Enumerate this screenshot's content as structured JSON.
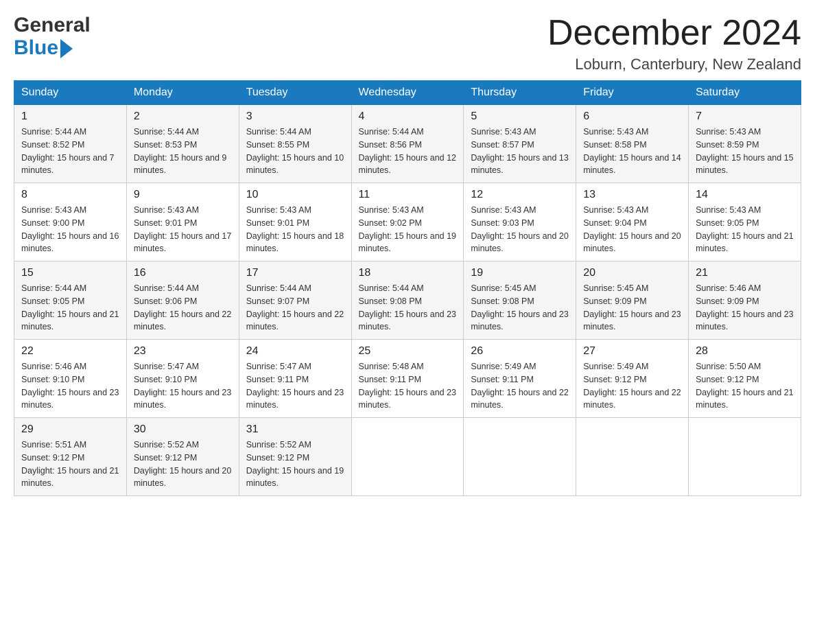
{
  "header": {
    "title": "December 2024",
    "location": "Loburn, Canterbury, New Zealand",
    "logo_general": "General",
    "logo_blue": "Blue"
  },
  "weekdays": [
    "Sunday",
    "Monday",
    "Tuesday",
    "Wednesday",
    "Thursday",
    "Friday",
    "Saturday"
  ],
  "weeks": [
    [
      {
        "day": "1",
        "sunrise": "Sunrise: 5:44 AM",
        "sunset": "Sunset: 8:52 PM",
        "daylight": "Daylight: 15 hours and 7 minutes."
      },
      {
        "day": "2",
        "sunrise": "Sunrise: 5:44 AM",
        "sunset": "Sunset: 8:53 PM",
        "daylight": "Daylight: 15 hours and 9 minutes."
      },
      {
        "day": "3",
        "sunrise": "Sunrise: 5:44 AM",
        "sunset": "Sunset: 8:55 PM",
        "daylight": "Daylight: 15 hours and 10 minutes."
      },
      {
        "day": "4",
        "sunrise": "Sunrise: 5:44 AM",
        "sunset": "Sunset: 8:56 PM",
        "daylight": "Daylight: 15 hours and 12 minutes."
      },
      {
        "day": "5",
        "sunrise": "Sunrise: 5:43 AM",
        "sunset": "Sunset: 8:57 PM",
        "daylight": "Daylight: 15 hours and 13 minutes."
      },
      {
        "day": "6",
        "sunrise": "Sunrise: 5:43 AM",
        "sunset": "Sunset: 8:58 PM",
        "daylight": "Daylight: 15 hours and 14 minutes."
      },
      {
        "day": "7",
        "sunrise": "Sunrise: 5:43 AM",
        "sunset": "Sunset: 8:59 PM",
        "daylight": "Daylight: 15 hours and 15 minutes."
      }
    ],
    [
      {
        "day": "8",
        "sunrise": "Sunrise: 5:43 AM",
        "sunset": "Sunset: 9:00 PM",
        "daylight": "Daylight: 15 hours and 16 minutes."
      },
      {
        "day": "9",
        "sunrise": "Sunrise: 5:43 AM",
        "sunset": "Sunset: 9:01 PM",
        "daylight": "Daylight: 15 hours and 17 minutes."
      },
      {
        "day": "10",
        "sunrise": "Sunrise: 5:43 AM",
        "sunset": "Sunset: 9:01 PM",
        "daylight": "Daylight: 15 hours and 18 minutes."
      },
      {
        "day": "11",
        "sunrise": "Sunrise: 5:43 AM",
        "sunset": "Sunset: 9:02 PM",
        "daylight": "Daylight: 15 hours and 19 minutes."
      },
      {
        "day": "12",
        "sunrise": "Sunrise: 5:43 AM",
        "sunset": "Sunset: 9:03 PM",
        "daylight": "Daylight: 15 hours and 20 minutes."
      },
      {
        "day": "13",
        "sunrise": "Sunrise: 5:43 AM",
        "sunset": "Sunset: 9:04 PM",
        "daylight": "Daylight: 15 hours and 20 minutes."
      },
      {
        "day": "14",
        "sunrise": "Sunrise: 5:43 AM",
        "sunset": "Sunset: 9:05 PM",
        "daylight": "Daylight: 15 hours and 21 minutes."
      }
    ],
    [
      {
        "day": "15",
        "sunrise": "Sunrise: 5:44 AM",
        "sunset": "Sunset: 9:05 PM",
        "daylight": "Daylight: 15 hours and 21 minutes."
      },
      {
        "day": "16",
        "sunrise": "Sunrise: 5:44 AM",
        "sunset": "Sunset: 9:06 PM",
        "daylight": "Daylight: 15 hours and 22 minutes."
      },
      {
        "day": "17",
        "sunrise": "Sunrise: 5:44 AM",
        "sunset": "Sunset: 9:07 PM",
        "daylight": "Daylight: 15 hours and 22 minutes."
      },
      {
        "day": "18",
        "sunrise": "Sunrise: 5:44 AM",
        "sunset": "Sunset: 9:08 PM",
        "daylight": "Daylight: 15 hours and 23 minutes."
      },
      {
        "day": "19",
        "sunrise": "Sunrise: 5:45 AM",
        "sunset": "Sunset: 9:08 PM",
        "daylight": "Daylight: 15 hours and 23 minutes."
      },
      {
        "day": "20",
        "sunrise": "Sunrise: 5:45 AM",
        "sunset": "Sunset: 9:09 PM",
        "daylight": "Daylight: 15 hours and 23 minutes."
      },
      {
        "day": "21",
        "sunrise": "Sunrise: 5:46 AM",
        "sunset": "Sunset: 9:09 PM",
        "daylight": "Daylight: 15 hours and 23 minutes."
      }
    ],
    [
      {
        "day": "22",
        "sunrise": "Sunrise: 5:46 AM",
        "sunset": "Sunset: 9:10 PM",
        "daylight": "Daylight: 15 hours and 23 minutes."
      },
      {
        "day": "23",
        "sunrise": "Sunrise: 5:47 AM",
        "sunset": "Sunset: 9:10 PM",
        "daylight": "Daylight: 15 hours and 23 minutes."
      },
      {
        "day": "24",
        "sunrise": "Sunrise: 5:47 AM",
        "sunset": "Sunset: 9:11 PM",
        "daylight": "Daylight: 15 hours and 23 minutes."
      },
      {
        "day": "25",
        "sunrise": "Sunrise: 5:48 AM",
        "sunset": "Sunset: 9:11 PM",
        "daylight": "Daylight: 15 hours and 23 minutes."
      },
      {
        "day": "26",
        "sunrise": "Sunrise: 5:49 AM",
        "sunset": "Sunset: 9:11 PM",
        "daylight": "Daylight: 15 hours and 22 minutes."
      },
      {
        "day": "27",
        "sunrise": "Sunrise: 5:49 AM",
        "sunset": "Sunset: 9:12 PM",
        "daylight": "Daylight: 15 hours and 22 minutes."
      },
      {
        "day": "28",
        "sunrise": "Sunrise: 5:50 AM",
        "sunset": "Sunset: 9:12 PM",
        "daylight": "Daylight: 15 hours and 21 minutes."
      }
    ],
    [
      {
        "day": "29",
        "sunrise": "Sunrise: 5:51 AM",
        "sunset": "Sunset: 9:12 PM",
        "daylight": "Daylight: 15 hours and 21 minutes."
      },
      {
        "day": "30",
        "sunrise": "Sunrise: 5:52 AM",
        "sunset": "Sunset: 9:12 PM",
        "daylight": "Daylight: 15 hours and 20 minutes."
      },
      {
        "day": "31",
        "sunrise": "Sunrise: 5:52 AM",
        "sunset": "Sunset: 9:12 PM",
        "daylight": "Daylight: 15 hours and 19 minutes."
      },
      null,
      null,
      null,
      null
    ]
  ]
}
